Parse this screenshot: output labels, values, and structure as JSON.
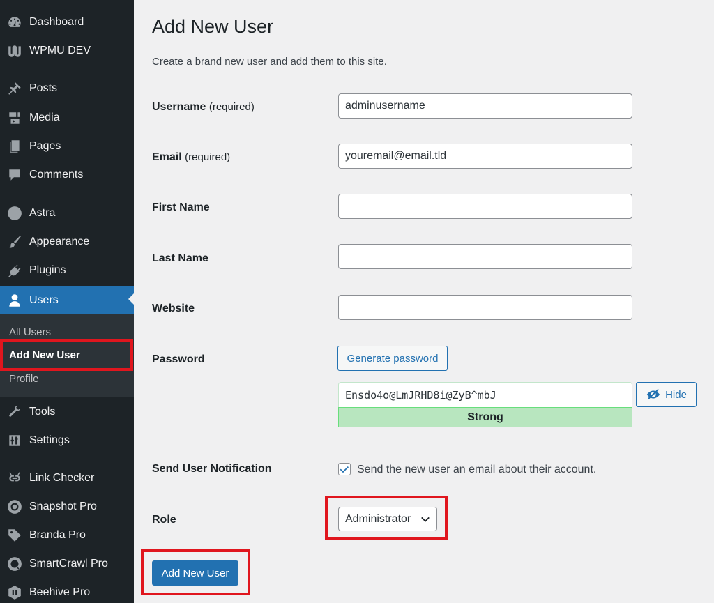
{
  "sidebar": {
    "items": [
      {
        "label": "Dashboard",
        "icon": "dashboard-icon"
      },
      {
        "label": "WPMU DEV",
        "icon": "wpmudev-icon"
      },
      {
        "label": "Posts",
        "icon": "pin-icon"
      },
      {
        "label": "Media",
        "icon": "media-icon"
      },
      {
        "label": "Pages",
        "icon": "pages-icon"
      },
      {
        "label": "Comments",
        "icon": "comments-icon"
      },
      {
        "label": "Astra",
        "icon": "astra-icon"
      },
      {
        "label": "Appearance",
        "icon": "paintbrush-icon"
      },
      {
        "label": "Plugins",
        "icon": "plugin-icon"
      },
      {
        "label": "Users",
        "icon": "user-icon"
      },
      {
        "label": "Tools",
        "icon": "wrench-icon"
      },
      {
        "label": "Settings",
        "icon": "settings-icon"
      },
      {
        "label": "Link Checker",
        "icon": "link-icon"
      },
      {
        "label": "Snapshot Pro",
        "icon": "snapshot-icon"
      },
      {
        "label": "Branda Pro",
        "icon": "tag-icon"
      },
      {
        "label": "SmartCrawl Pro",
        "icon": "smartcrawl-icon"
      },
      {
        "label": "Beehive Pro",
        "icon": "beehive-icon"
      }
    ],
    "active_item": "Users",
    "submenu": [
      "All Users",
      "Add New User",
      "Profile"
    ],
    "submenu_current": "Add New User"
  },
  "page": {
    "title": "Add New User",
    "description": "Create a brand new user and add them to this site."
  },
  "form": {
    "username": {
      "label": "Username",
      "note": "(required)",
      "value": "adminusername"
    },
    "email": {
      "label": "Email",
      "note": "(required)",
      "value": "youremail@email.tld"
    },
    "first_name": {
      "label": "First Name",
      "value": ""
    },
    "last_name": {
      "label": "Last Name",
      "value": ""
    },
    "website": {
      "label": "Website",
      "value": ""
    },
    "password": {
      "label": "Password",
      "generate_label": "Generate password",
      "value": "Ensdo4o@LmJRHD8i@ZyB^mbJ",
      "hide_label": "Hide",
      "strength": "Strong"
    },
    "notification": {
      "label": "Send User Notification",
      "checkbox_label": "Send the new user an email about their account.",
      "checked": true
    },
    "role": {
      "label": "Role",
      "selected": "Administrator"
    },
    "submit_label": "Add New User"
  },
  "colors": {
    "sidebar_bg": "#1d2327",
    "accent": "#2271b1",
    "highlight": "#e0161e",
    "strength_bg": "#b8e6bf"
  }
}
